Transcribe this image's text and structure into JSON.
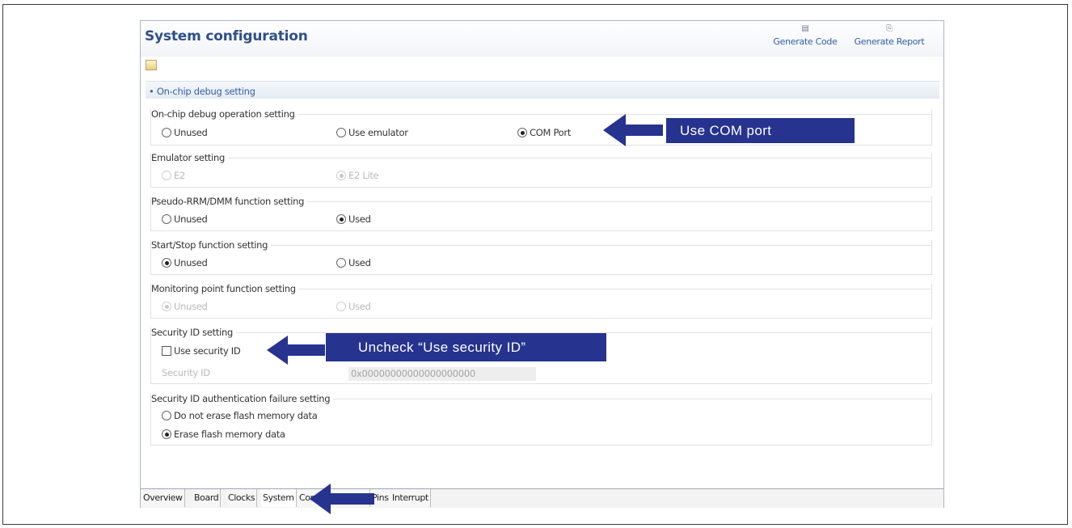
{
  "window": {
    "title": "System configuration",
    "generate_code": "Generate Code",
    "generate_report": "Generate Report"
  },
  "section": {
    "label": "On-chip debug setting"
  },
  "groups": {
    "debug_operation": {
      "title": "On-chip debug operation setting",
      "options": [
        "Unused",
        "Use emulator",
        "COM Port"
      ],
      "selected": "COM Port"
    },
    "emulator": {
      "title": "Emulator setting",
      "options": [
        "E2",
        "E2 Lite"
      ],
      "selected": "E2 Lite",
      "disabled": true
    },
    "pseudo_rrm": {
      "title": "Pseudo-RRM/DMM function setting",
      "options": [
        "Unused",
        "Used"
      ],
      "selected": "Used"
    },
    "start_stop": {
      "title": "Start/Stop function setting",
      "options": [
        "Unused",
        "Used"
      ],
      "selected": "Unused"
    },
    "monitoring": {
      "title": "Monitoring point function setting",
      "options": [
        "Unused",
        "Used"
      ],
      "selected": "Unused",
      "disabled": true
    },
    "security_id": {
      "title": "Security ID setting",
      "checkbox_label": "Use security ID",
      "checked": false,
      "field_label": "Security ID",
      "field_value": "0x00000000000000000000"
    },
    "auth_failure": {
      "title": "Security ID authentication failure setting",
      "options": [
        "Do not erase flash memory data",
        "Erase flash memory data"
      ],
      "selected": "Erase flash memory data"
    }
  },
  "tabs": [
    "Overview",
    "Board",
    "Clocks",
    "System",
    "Components",
    "Pins",
    "Interrupt"
  ],
  "active_tab": "System",
  "callouts": {
    "com_port": "Use COM  port",
    "security": "Uncheck “Use security ID”"
  },
  "colors": {
    "callout_bg": "#26338f",
    "arrow": "#26338f",
    "title": "#2f4f8c",
    "link": "#2f5ea8"
  },
  "icons": {
    "generate_code": "generate-code-icon",
    "generate_report": "printer-icon",
    "toolbar": "restore-defaults-icon"
  }
}
